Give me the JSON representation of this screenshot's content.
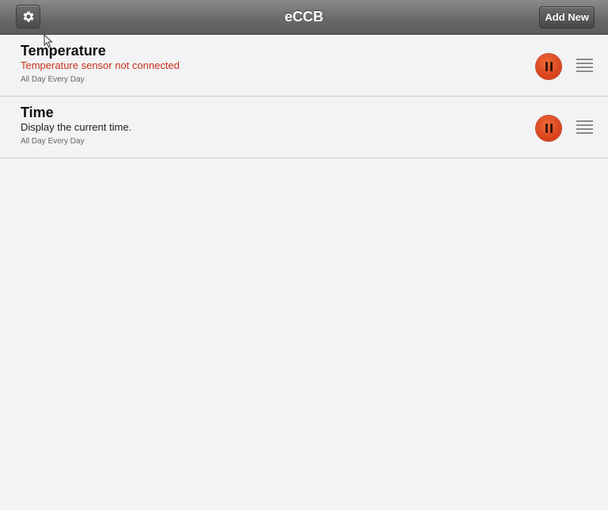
{
  "header": {
    "title": "eCCB",
    "add_label": "Add New",
    "settings_icon": "gear-icon"
  },
  "rows": [
    {
      "name": "Temperature",
      "description": "Temperature sensor not connected",
      "description_status": "error",
      "schedule": "All Day Every Day",
      "action_icon": "pause-icon",
      "handle_icon": "drag-handle-icon"
    },
    {
      "name": "Time",
      "description": "Display the current time.",
      "description_status": "normal",
      "schedule": "All Day Every Day",
      "action_icon": "pause-icon",
      "handle_icon": "drag-handle-icon"
    }
  ],
  "colors": {
    "header_dark": "#5a5a5a",
    "error_text": "#c7301c",
    "pause_button": "#e14f25",
    "background": "#f3f4f4"
  }
}
